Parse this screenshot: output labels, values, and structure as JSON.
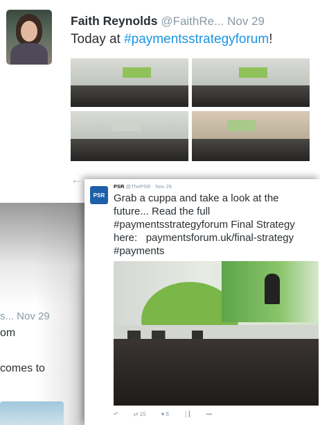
{
  "tweet1": {
    "name": "Faith Reynolds",
    "handle": "@FaithRe...",
    "date": "Nov 29",
    "text_prefix": "Today at ",
    "hashtag": "#paymentsstrategyforum",
    "text_suffix": "!",
    "actions": {
      "reply_icon": "reply-icon",
      "retweet_icon": "retweet-icon",
      "like_icon": "heart-icon"
    }
  },
  "tweet2": {
    "header": "s...  Nov 29",
    "line1": "om",
    "line2": "comes to"
  },
  "tweet3": {
    "avatar_label": "PSR",
    "name": "PSR",
    "handle": "@ThePSR",
    "date": "Nov 29",
    "text_line1": "Grab a cuppa and take a look at the",
    "text_line2": "future... Read the full",
    "hashtag1": "#paymentsstrategyforum",
    "text_line3_suffix": " Final Strategy",
    "text_line4_prefix": "here:   ",
    "link": "paymentsforum.uk/final-strategy",
    "hashtag2": "#payments",
    "retweets": "15",
    "likes": "6"
  },
  "colors": {
    "hashtag": "#1b95e0",
    "muted": "#8899a6",
    "psr_blue": "#1d5fa8"
  }
}
